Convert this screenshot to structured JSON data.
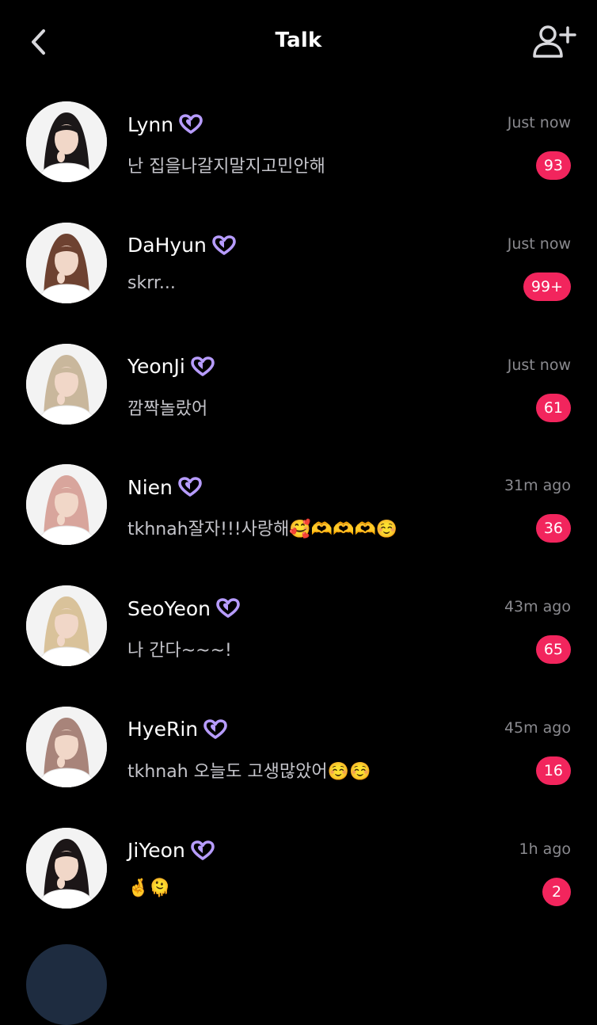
{
  "header": {
    "title": "Talk",
    "back_icon": "chevron-left-icon",
    "add_icon": "add-user-icon"
  },
  "colors": {
    "background": "#000000",
    "badge": "#f2255d",
    "verified": "#b79cff",
    "muted": "#8a8a8f"
  },
  "chats": [
    {
      "name": "Lynn",
      "time": "Just now",
      "preview": "난 집을나갈지말지고민안해",
      "badge": "93",
      "hair": "#1b1718"
    },
    {
      "name": "DaHyun",
      "time": "Just now",
      "preview": "skrr...",
      "badge": "99+",
      "hair": "#6e4231"
    },
    {
      "name": "YeonJi",
      "time": "Just now",
      "preview": "깜짝놀랐어",
      "badge": "61",
      "hair": "#c9b79c"
    },
    {
      "name": "Nien",
      "time": "31m ago",
      "preview": "tkhnah잘자!!!사랑해🥰🫶🫶🫶☺️",
      "badge": "36",
      "hair": "#d8a59c"
    },
    {
      "name": "SeoYeon",
      "time": "43m ago",
      "preview": "나 간다~~~!",
      "badge": "65",
      "hair": "#d9c29a"
    },
    {
      "name": "HyeRin",
      "time": "45m ago",
      "preview": "tkhnah 오늘도 고생많았어☺️☺️",
      "badge": "16",
      "hair": "#a8847a"
    },
    {
      "name": "JiYeon",
      "time": "1h ago",
      "preview": "🤞🫠",
      "badge": "2",
      "hair": "#1c1617"
    }
  ]
}
